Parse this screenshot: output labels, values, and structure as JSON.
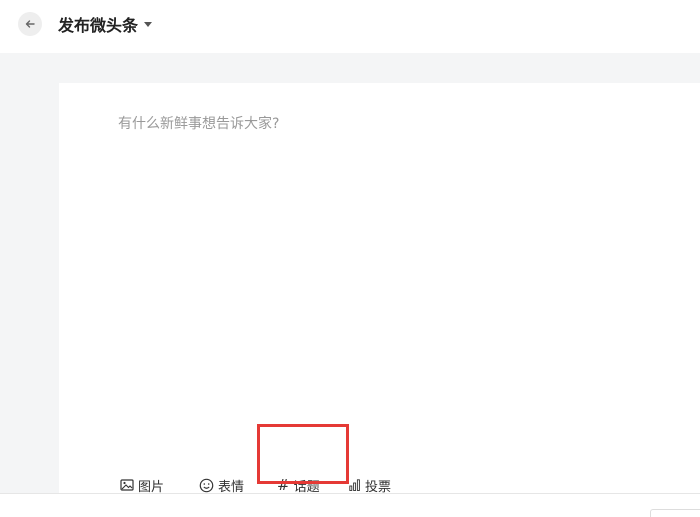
{
  "header": {
    "title": "发布微头条",
    "back_icon": "arrow-left-icon",
    "dropdown_icon": "caret-down-icon"
  },
  "editor": {
    "placeholder": "有什么新鲜事想告诉大家?",
    "value": ""
  },
  "toolbar": {
    "items": [
      {
        "label": "图片",
        "icon": "image-icon"
      },
      {
        "label": "表情",
        "icon": "smiley-icon"
      },
      {
        "label": "话题",
        "icon": "hashtag-icon",
        "glyph": "#"
      },
      {
        "label": "投票",
        "icon": "bar-chart-icon"
      }
    ]
  },
  "colors": {
    "workspace_bg": "#f4f5f6",
    "highlight": "#e53935",
    "placeholder": "#999999"
  }
}
